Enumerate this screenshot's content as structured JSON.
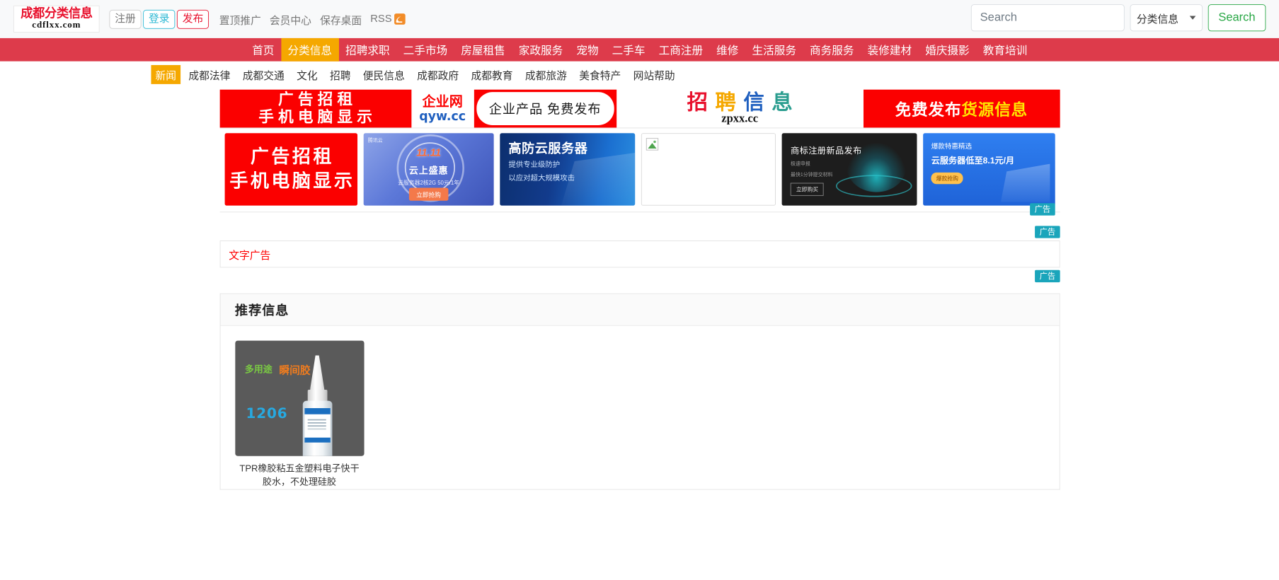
{
  "header": {
    "logo": {
      "line1": "成都分类信息",
      "line2": "cdflxx.com"
    },
    "buttons": [
      {
        "label": "注册",
        "name": "register"
      },
      {
        "label": "登录",
        "name": "login"
      },
      {
        "label": "发布",
        "name": "publish"
      }
    ],
    "links": [
      {
        "label": "置顶推广"
      },
      {
        "label": "会员中心"
      },
      {
        "label": "保存桌面"
      }
    ],
    "rss": {
      "label": "RSS",
      "icon": "rss-icon"
    },
    "search": {
      "placeholder": "Search",
      "value": "",
      "category_selected": "分类信息",
      "button_label": "Search",
      "dropdown_icon": "chevron-down-icon"
    }
  },
  "mainnav": {
    "items": [
      {
        "label": "首页",
        "active": false
      },
      {
        "label": "分类信息",
        "active": true
      },
      {
        "label": "招聘求职",
        "active": false
      },
      {
        "label": "二手市场",
        "active": false
      },
      {
        "label": "房屋租售",
        "active": false
      },
      {
        "label": "家政服务",
        "active": false
      },
      {
        "label": "宠物",
        "active": false
      },
      {
        "label": "二手车",
        "active": false
      },
      {
        "label": "工商注册",
        "active": false
      },
      {
        "label": "维修",
        "active": false
      },
      {
        "label": "生活服务",
        "active": false
      },
      {
        "label": "商务服务",
        "active": false
      },
      {
        "label": "装修建材",
        "active": false
      },
      {
        "label": "婚庆摄影",
        "active": false
      },
      {
        "label": "教育培训",
        "active": false
      }
    ]
  },
  "subnav": {
    "items": [
      {
        "label": "新闻",
        "active": true
      },
      {
        "label": "成都法律",
        "active": false
      },
      {
        "label": "成都交通",
        "active": false
      },
      {
        "label": "文化",
        "active": false
      },
      {
        "label": "招聘",
        "active": false
      },
      {
        "label": "便民信息",
        "active": false
      },
      {
        "label": "成都政府",
        "active": false
      },
      {
        "label": "成都教育",
        "active": false
      },
      {
        "label": "成都旅游",
        "active": false
      },
      {
        "label": "美食特产",
        "active": false
      },
      {
        "label": "网站帮助",
        "active": false
      }
    ]
  },
  "banner_row1": {
    "ad_rent": {
      "line1": "广告招租",
      "line2": "手机电脑显示"
    },
    "qyw": {
      "line1": "企业网",
      "line2": "qyw.cc"
    },
    "free_publish": {
      "text": "企业产品 免费发布"
    },
    "recruit": {
      "char1": "招",
      "char2": "聘",
      "char3": "信",
      "char4": "息",
      "domain": "zpxx.cc"
    },
    "supply": {
      "white": "免费发布",
      "yellow": "货源信息"
    }
  },
  "banner_row2": {
    "ad_tag": "广告",
    "cards": [
      {
        "name": "ad-rent",
        "line1": "广告招租",
        "line2": "手机电脑显示"
      },
      {
        "name": "tencent-cloud",
        "brand": "腾讯云",
        "promo": "11.11",
        "title": "云上盛惠",
        "sub": "云服务器2核2G 50元/1年",
        "cta": "立即抢购"
      },
      {
        "name": "anti-ddos-server",
        "title": "高防云服务器",
        "sub1": "提供专业级防护",
        "sub2": "以应对超大规模攻击"
      },
      {
        "name": "broken-image-ad",
        "icon": "broken-image-icon"
      },
      {
        "name": "trademark-ad",
        "title": "商标注册新品发布",
        "sub1": "极速申报",
        "sub2": "最快1分钟提交材料",
        "cta": "立即购买"
      },
      {
        "name": "cloud-discount-ad",
        "title": "爆款特惠精选",
        "sub": "云服务器低至8.1元/月",
        "pill": "爆款抢购"
      }
    ]
  },
  "text_ad": {
    "tag_top": "广告",
    "label": "文字广告",
    "tag_bottom": "广告"
  },
  "recommend": {
    "title": "推荐信息",
    "items": [
      {
        "caption": "TPR橡胶粘五金塑料电子快干胶水，不处理硅胶",
        "thumb": {
          "tag1": "多用途",
          "tag2": "瞬间胶",
          "code": "1206"
        }
      }
    ]
  },
  "colors": {
    "brand_red": "#dd3b4b",
    "accent_yellow": "#f5a800",
    "ad_tag_teal": "#1aa5bb",
    "logo_red": "#e8112d",
    "link_gray": "#777777",
    "search_green": "#28a745"
  }
}
